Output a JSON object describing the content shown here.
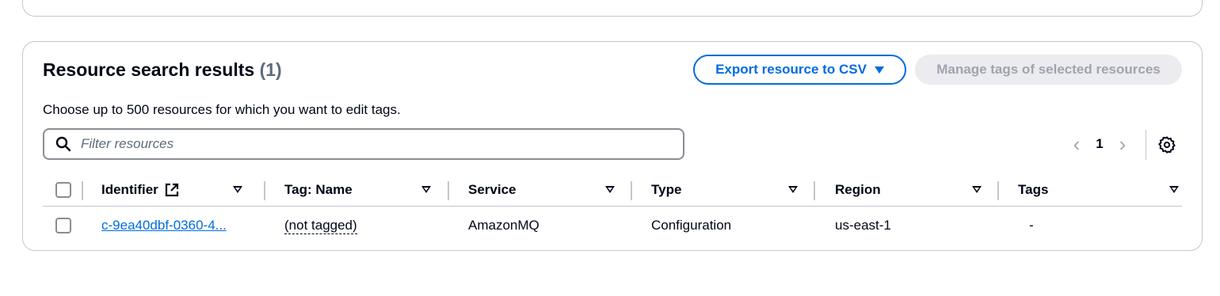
{
  "panel": {
    "title": "Resource search results",
    "count": "(1)",
    "description": "Choose up to 500 resources for which you want to edit tags."
  },
  "actions": {
    "export_label": "Export resource to CSV",
    "manage_label": "Manage tags of selected resources"
  },
  "search": {
    "placeholder": "Filter resources",
    "icon": "search-icon"
  },
  "pagination": {
    "current_page": "1",
    "prev_icon": "chevron-left-icon",
    "next_icon": "chevron-right-icon"
  },
  "settings": {
    "icon": "gear-icon"
  },
  "table": {
    "columns": [
      {
        "label": "Identifier"
      },
      {
        "label": "Tag: Name"
      },
      {
        "label": "Service"
      },
      {
        "label": "Type"
      },
      {
        "label": "Region"
      },
      {
        "label": "Tags"
      }
    ],
    "rows": [
      {
        "identifier": "c-9ea40dbf-0360-4...",
        "tag_name": "(not tagged)",
        "service": "AmazonMQ",
        "type": "Configuration",
        "region": "us-east-1",
        "tags": "-"
      }
    ]
  },
  "colors": {
    "accent": "#006ce0",
    "text": "#000716",
    "muted": "#5f6b7a",
    "border": "#c6c6cd",
    "disabled_bg": "#ebebf0"
  }
}
